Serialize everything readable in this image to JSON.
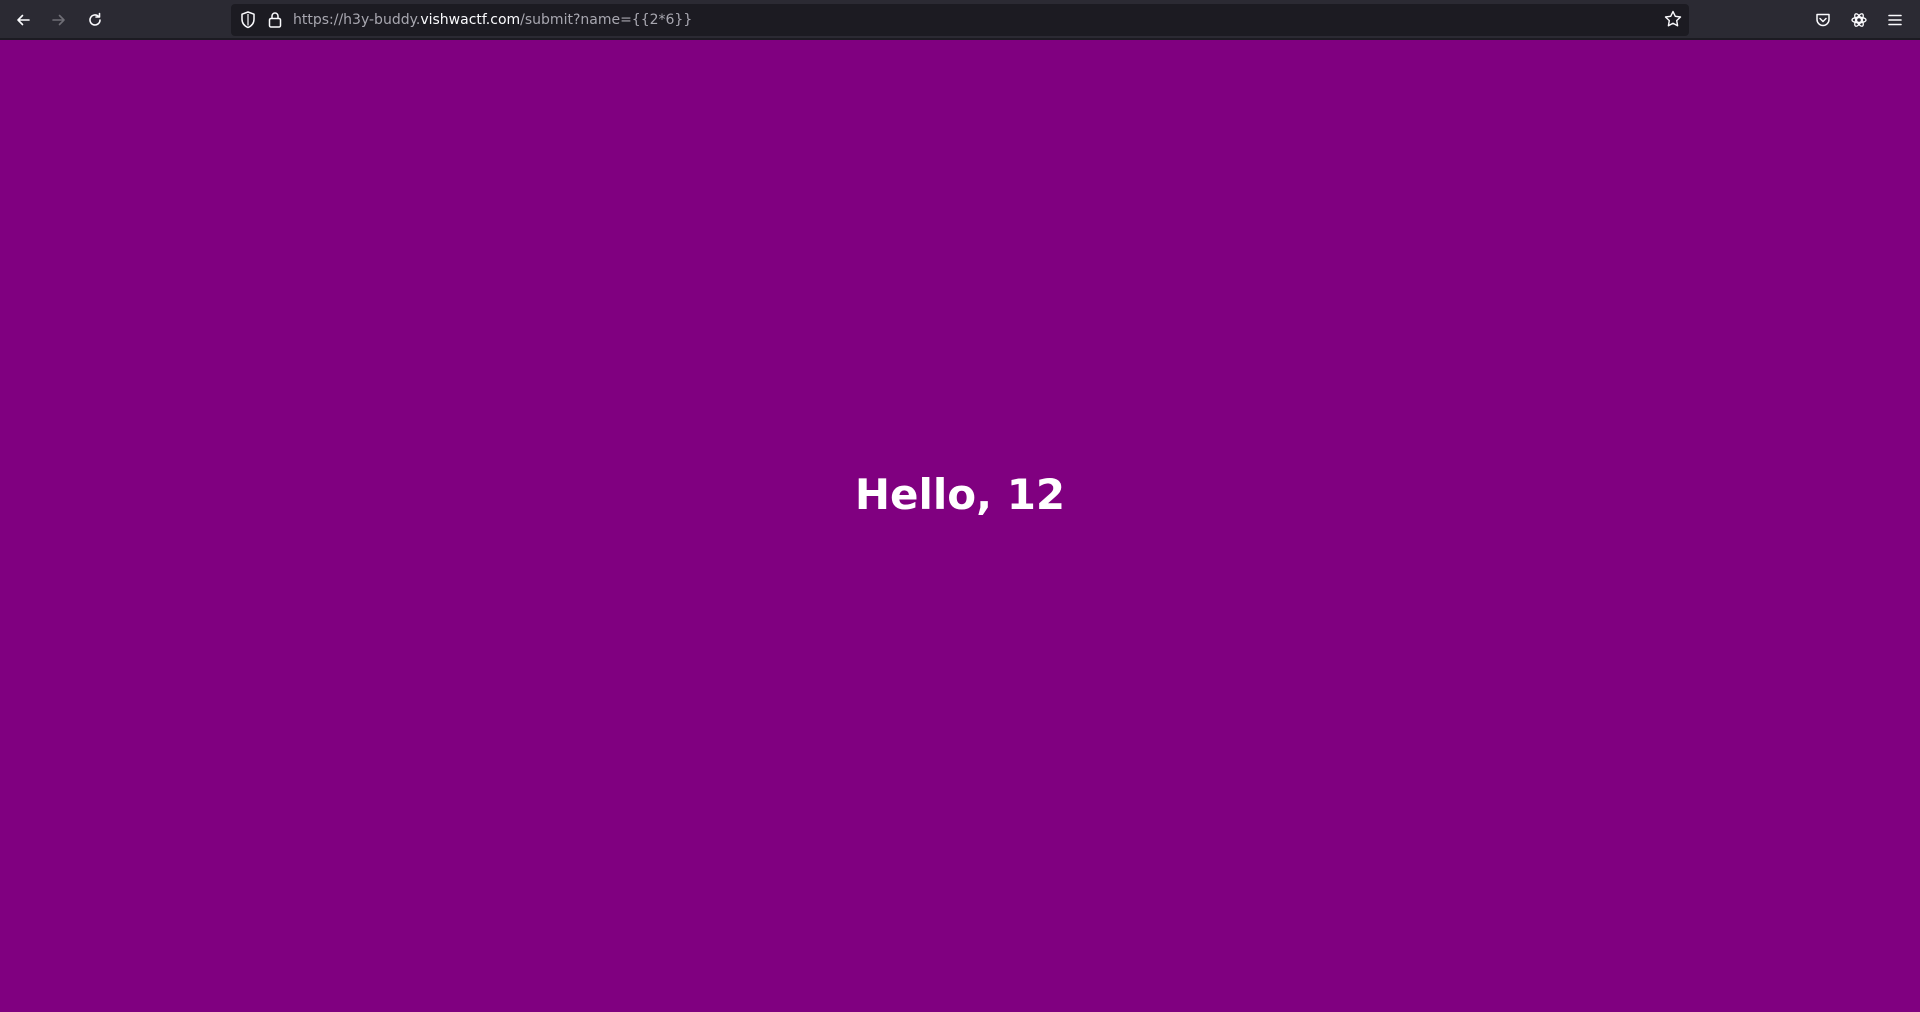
{
  "browser": {
    "url_scheme": "https://h3y-buddy.",
    "url_host": "vishwactf.com",
    "url_path": "/submit?name={{2*6}}",
    "icons": {
      "back": "back-arrow-icon",
      "forward": "forward-arrow-icon",
      "reload": "reload-icon",
      "shield": "tracking-protection-shield-icon",
      "lock": "lock-icon",
      "bookmark": "star-icon",
      "pocket": "pocket-icon",
      "extension": "extension-gear-icon",
      "menu": "hamburger-menu-icon"
    }
  },
  "page": {
    "background": "#800080",
    "greeting": "Hello, 12"
  }
}
